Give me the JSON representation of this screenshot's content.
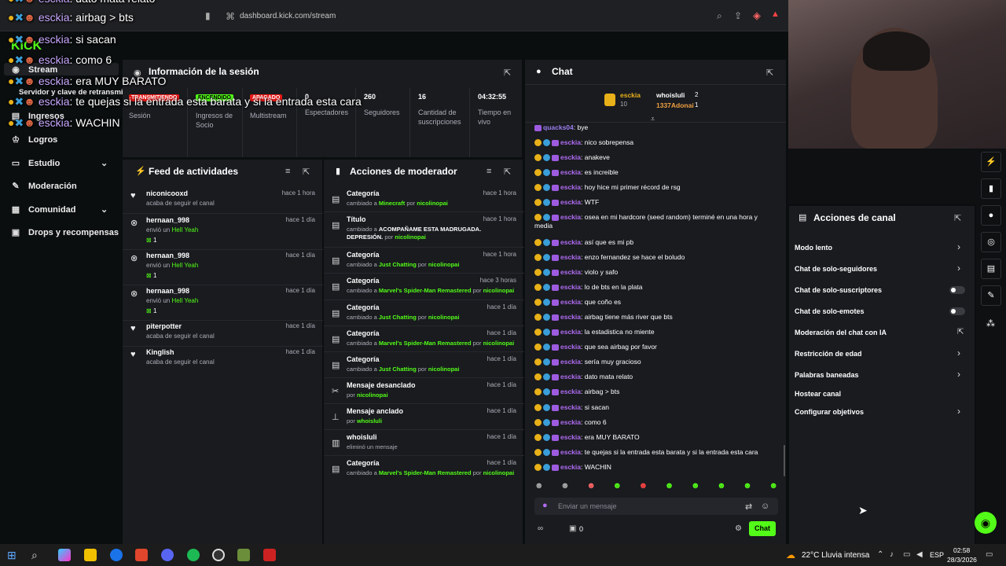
{
  "browser": {
    "url": "dashboard.kick.com/stream"
  },
  "sidebar": {
    "logo": "KICK",
    "items": [
      {
        "label": "Stream",
        "icon": "stream-icon"
      },
      {
        "label": "Servidor y clave de retransmisión"
      },
      {
        "label": "Ingresos"
      },
      {
        "label": "Logros"
      },
      {
        "label": "Estudio"
      },
      {
        "label": "Moderación"
      },
      {
        "label": "Comunidad"
      },
      {
        "label": "Drops y recompensas"
      }
    ]
  },
  "session": {
    "title": "Información de la sesión",
    "badges": [
      "TRANSMITIENDO",
      "ENCENDIDO",
      "APAGADO"
    ],
    "stats": [
      {
        "value": "",
        "label": "Sesión"
      },
      {
        "value": "",
        "label": "Ingresos de Socio"
      },
      {
        "value": "",
        "label": "Multistream"
      },
      {
        "value": "0",
        "label": "Espectadores"
      },
      {
        "value": "260",
        "label": "Seguidores"
      },
      {
        "value": "16",
        "label": "Cantidad de suscripciones"
      },
      {
        "value": "04:32:55",
        "label": "Tiempo en vivo"
      }
    ]
  },
  "feed": {
    "title": "Feed de actividades",
    "items": [
      {
        "name": "niconicooxd",
        "sub": "acaba de seguir el canal",
        "time": "hace 1 hora"
      },
      {
        "name": "hernaan_998",
        "sub_pre": "envió un",
        "sub_hl": "Hell Yeah",
        "count": "1",
        "time": "hace 1 día"
      },
      {
        "name": "hernaan_998",
        "sub_pre": "envió un",
        "sub_hl": "Hell Yeah",
        "count": "1",
        "time": "hace 1 día"
      },
      {
        "name": "hernaan_998",
        "sub_pre": "envió un",
        "sub_hl": "Hell Yeah",
        "count": "1",
        "time": "hace 1 día"
      },
      {
        "name": "piterpotter",
        "sub": "acaba de seguir el canal",
        "time": "hace 1 día"
      },
      {
        "name": "Kinglish",
        "sub": "acaba de seguir el canal",
        "time": "hace 1 día"
      }
    ]
  },
  "mod": {
    "title": "Acciones de moderador",
    "items": [
      {
        "title": "Categoría",
        "pre": "cambiado a",
        "hl": "Minecraft",
        "by": "por",
        "user": "nicolinopai",
        "time": "hace 1 hora"
      },
      {
        "title": "Título",
        "pre": "cambiado a",
        "hl": "ACOMPAÑAME ESTA MADRUGADA. DEPRESIÓN.",
        "by": "por",
        "user": "nicolinopai",
        "time": "hace 1 hora"
      },
      {
        "title": "Categoría",
        "pre": "cambiado a",
        "hl": "Just Chatting",
        "by": "por",
        "user": "nicolinopai",
        "time": "hace 1 hora"
      },
      {
        "title": "Categoría",
        "pre": "cambiado a",
        "hl": "Marvel's Spider-Man Remastered",
        "by": "por",
        "user": "nicolinopai",
        "time": "hace 3 horas"
      },
      {
        "title": "Categoría",
        "pre": "cambiado a",
        "hl": "Just Chatting",
        "by": "por",
        "user": "nicolinopai",
        "time": "hace 1 día"
      },
      {
        "title": "Categoría",
        "pre": "cambiado a",
        "hl": "Marvel's Spider-Man Remastered",
        "by": "por",
        "user": "nicolinopai",
        "time": "hace 1 día"
      },
      {
        "title": "Categoría",
        "pre": "cambiado a",
        "hl": "Just Chatting",
        "by": "por",
        "user": "nicolinopai",
        "time": "hace 1 día"
      },
      {
        "title": "Mensaje desanclado",
        "pre": "",
        "hl": "",
        "by": "por",
        "user": "nicolinopai",
        "time": "hace 1 día"
      },
      {
        "title": "Mensaje anclado",
        "pre": "",
        "hl": "",
        "by": "por",
        "user": "whoisluli",
        "time": "hace 1 día"
      },
      {
        "title": "whoisluli",
        "pre": "eliminó un mensaje",
        "hl": "",
        "by": "",
        "user": "",
        "time": "hace 1 día"
      },
      {
        "title": "Categoría",
        "pre": "cambiado a",
        "hl": "Marvel's Spider-Man Remastered",
        "by": "por",
        "user": "nicolinopai",
        "time": "hace 1 día"
      }
    ]
  },
  "chat": {
    "title": "Chat",
    "top": {
      "u1": "esckia",
      "n1": "10",
      "u2": "whoisluli",
      "n2": "2",
      "u3": "1337Adonai",
      "n3": "1"
    },
    "first": {
      "user": "quacks04",
      "text": "bye"
    },
    "messages": [
      {
        "user": "esckia",
        "text": "nico sobrepensa"
      },
      {
        "user": "esckia",
        "text": "anakeve"
      },
      {
        "user": "esckia",
        "text": "es increible"
      },
      {
        "user": "esckia",
        "text": "hoy hice mi primer récord de rsg"
      },
      {
        "user": "esckia",
        "text": "WTF"
      },
      {
        "user": "esckia",
        "text": "osea en mi hardcore (seed random) terminé en una hora y"
      },
      {
        "user": "",
        "text": "media"
      },
      {
        "user": "esckia",
        "text": "así que es mi pb"
      },
      {
        "user": "esckia",
        "text": "enzo fernandez se hace el boludo"
      },
      {
        "user": "esckia",
        "text": "violo y safo"
      },
      {
        "user": "esckia",
        "text": "lo de bts en la plata"
      },
      {
        "user": "esckia",
        "text": "que coño es"
      },
      {
        "user": "esckia",
        "text": "airbag tiene más river que bts"
      },
      {
        "user": "esckia",
        "text": "la estadistica no miente"
      },
      {
        "user": "esckia",
        "text": "que sea airbag por favor"
      },
      {
        "user": "esckia",
        "text": "sería muy gracioso"
      },
      {
        "user": "esckia",
        "text": "dato mata relato"
      },
      {
        "user": "esckia",
        "text": "airbag > bts"
      },
      {
        "user": "esckia",
        "text": "si sacan"
      },
      {
        "user": "esckia",
        "text": "como 6"
      },
      {
        "user": "esckia",
        "text": "era MUY BARATO"
      },
      {
        "user": "esckia",
        "text": "te quejas si la entrada esta barata y si la entrada esta cara"
      },
      {
        "user": "esckia",
        "text": "WACHIN"
      }
    ],
    "placeholder": "Enviar un mensaje",
    "bottom_count": "0",
    "send": "Chat"
  },
  "channel": {
    "title": "Acciones de canal",
    "items": [
      {
        "label": "Modo lento",
        "ctrl": "chevron"
      },
      {
        "label": "Chat de solo-seguidores",
        "ctrl": "chevron"
      },
      {
        "label": "Chat de solo-suscriptores",
        "ctrl": "toggle"
      },
      {
        "label": "Chat de solo-emotes",
        "ctrl": "toggle"
      },
      {
        "label": "Moderación del chat con IA",
        "ctrl": "external"
      },
      {
        "label": "Restricción de edad",
        "ctrl": "chevron"
      },
      {
        "label": "Palabras baneadas",
        "ctrl": "chevron"
      },
      {
        "label": "Hostear canal",
        "ctrl": "none"
      },
      {
        "label": "Configurar objetivos",
        "ctrl": "chevron"
      }
    ]
  },
  "overlay": [
    {
      "user": "esckia",
      "text": "dato mata relato"
    },
    {
      "user": "esckia",
      "text": "airbag > bts"
    },
    {
      "user": "esckia",
      "text": "si sacan"
    },
    {
      "user": "esckia",
      "text": "como 6"
    },
    {
      "user": "esckia",
      "text": "era MUY BARATO"
    },
    {
      "user": "esckia",
      "text": "te quejas si la entrada esta barata y si la entrada esta cara"
    },
    {
      "user": "esckia",
      "text": "WACHIN"
    }
  ],
  "taskbar": {
    "weather": "22°C  Lluvia intensa",
    "lang": "ESP",
    "time": "02:58",
    "date": "28/3/2026"
  }
}
